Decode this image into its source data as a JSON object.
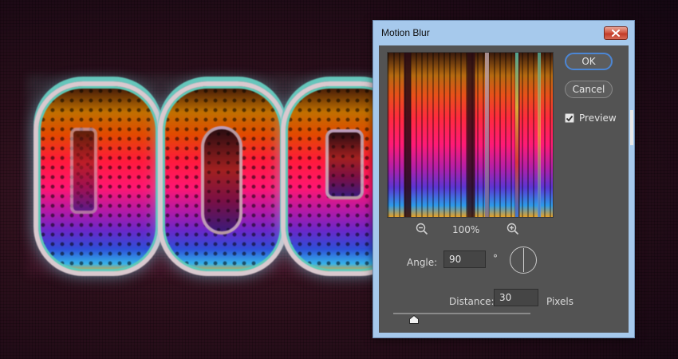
{
  "dialog": {
    "title": "Motion Blur",
    "buttons": {
      "ok": "OK",
      "cancel": "Cancel"
    },
    "preview_checkbox": {
      "label": "Preview",
      "checked": true
    },
    "zoom": {
      "level": "100%"
    },
    "angle": {
      "label": "Angle:",
      "value": "90",
      "unit": "°"
    },
    "distance": {
      "label": "Distance:",
      "value": "30",
      "unit": "Pixels",
      "slider_level_fraction": 0.1
    }
  },
  "icons": [
    "close-icon",
    "zoom-out-icon",
    "zoom-in-icon",
    "angle-dial-icon",
    "checkmark-icon",
    "slider-thumb-icon"
  ],
  "colors": {
    "titlebar": "#a6c9ec",
    "panel": "#535353",
    "close_button": "#c23b28",
    "ok_border": "#4c86d4"
  }
}
